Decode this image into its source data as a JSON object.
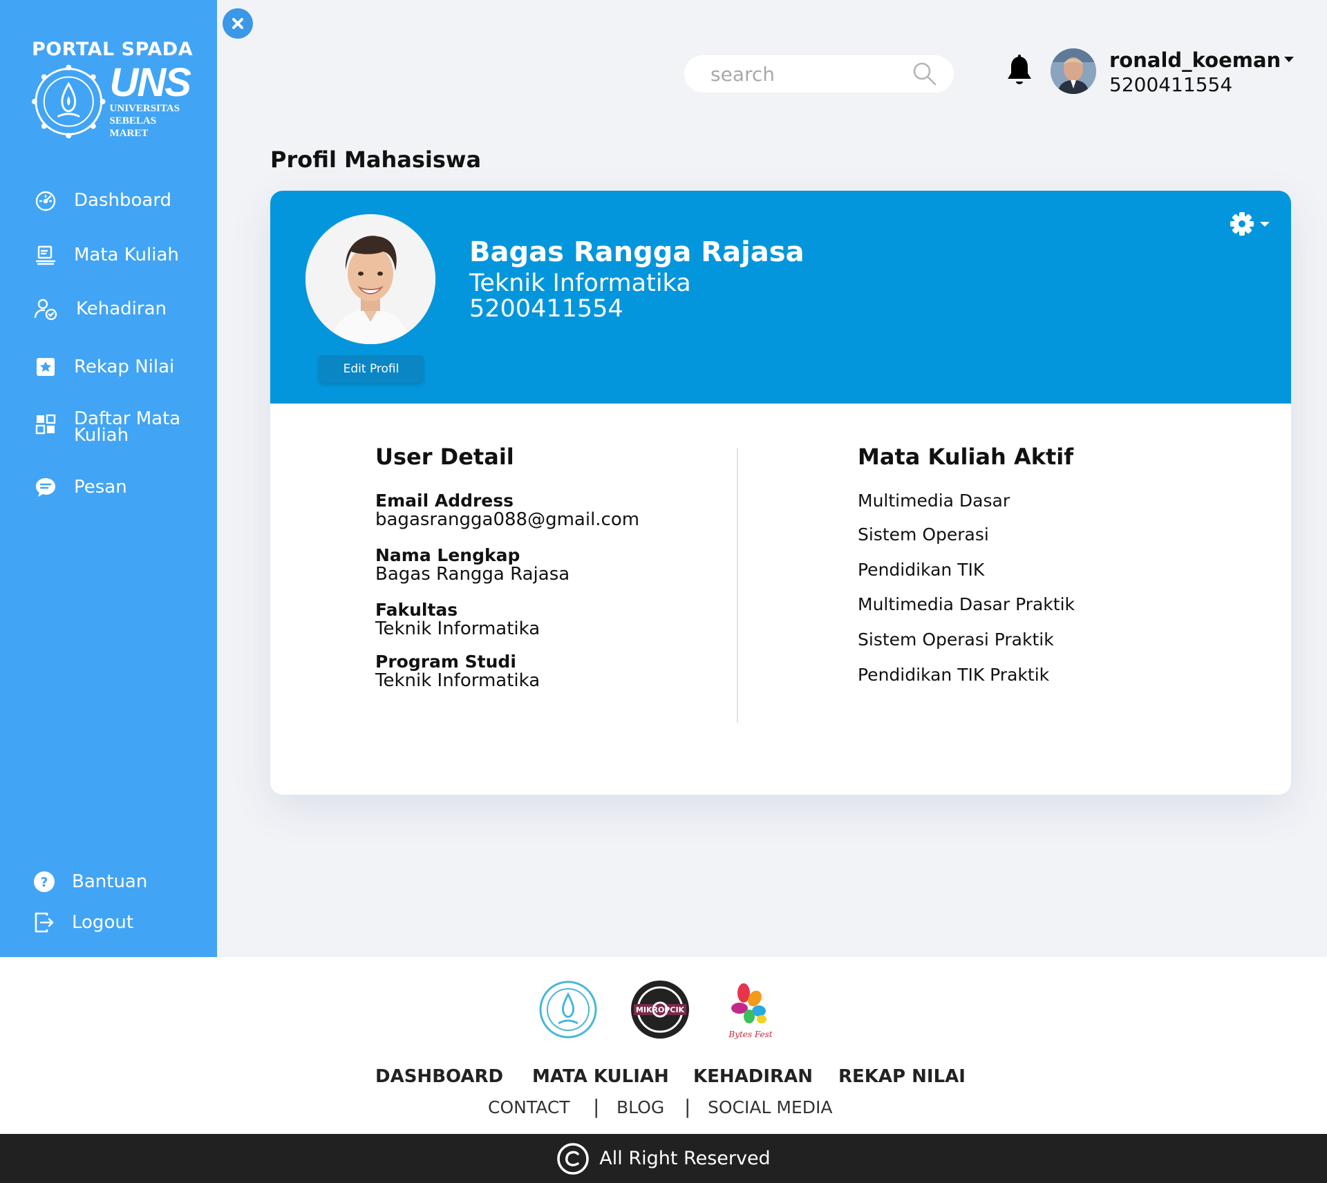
{
  "brand": {
    "title": "PORTAL SPADA",
    "logo_text": "UNS",
    "logo_sub1": "UNIVERSITAS",
    "logo_sub2": "SEBELAS MARET"
  },
  "sidebar": {
    "items": [
      {
        "label": "Dashboard",
        "icon": "gauge-icon"
      },
      {
        "label": "Mata Kuliah",
        "icon": "laptop-icon"
      },
      {
        "label": "Kehadiran",
        "icon": "user-check-icon"
      },
      {
        "label": "Rekap Nilai",
        "icon": "star-box-icon"
      },
      {
        "label": "Daftar Mata Kuliah",
        "icon": "grid-icon"
      },
      {
        "label": "Pesan",
        "icon": "chat-icon"
      }
    ],
    "bottom": [
      {
        "label": "Bantuan",
        "icon": "help-icon"
      },
      {
        "label": "Logout",
        "icon": "logout-icon"
      }
    ]
  },
  "header": {
    "search_placeholder": "search",
    "username": "ronald_koeman",
    "user_id": "5200411554"
  },
  "page_title": "Profil Mahasiswa",
  "profile": {
    "name": "Bagas Rangga Rajasa",
    "major": "Teknik Informatika",
    "nim": "5200411554",
    "edit_label": "Edit Profil"
  },
  "user_detail": {
    "title": "User Detail",
    "fields": [
      {
        "label": "Email Address",
        "value": "bagasrangga088@gmail.com"
      },
      {
        "label": "Nama Lengkap",
        "value": "Bagas Rangga Rajasa"
      },
      {
        "label": "Fakultas",
        "value": "Teknik Informatika"
      },
      {
        "label": "Program Studi",
        "value": "Teknik Informatika"
      }
    ]
  },
  "courses": {
    "title": "Mata Kuliah Aktif",
    "items": [
      "Multimedia Dasar",
      "Sistem Operasi",
      "Pendidikan TIK",
      "Multimedia Dasar Praktik",
      "Sistem Operasi Praktik",
      "Pendidikan TIK Praktik"
    ]
  },
  "footer": {
    "logo3_text": "Bytes Fest",
    "logo2_text": "MIKROPCIK",
    "nav": [
      "DASHBOARD",
      "MATA KULIAH",
      "KEHADIRAN",
      "REKAP NILAI"
    ],
    "sub": [
      "CONTACT",
      "BLOG",
      "SOCIAL MEDIA"
    ],
    "separator": "|",
    "copyright": "All Right Reserved"
  },
  "colors": {
    "sidebar": "#42a4f4",
    "card_header": "#0496dc",
    "footer_bar": "#212121"
  }
}
